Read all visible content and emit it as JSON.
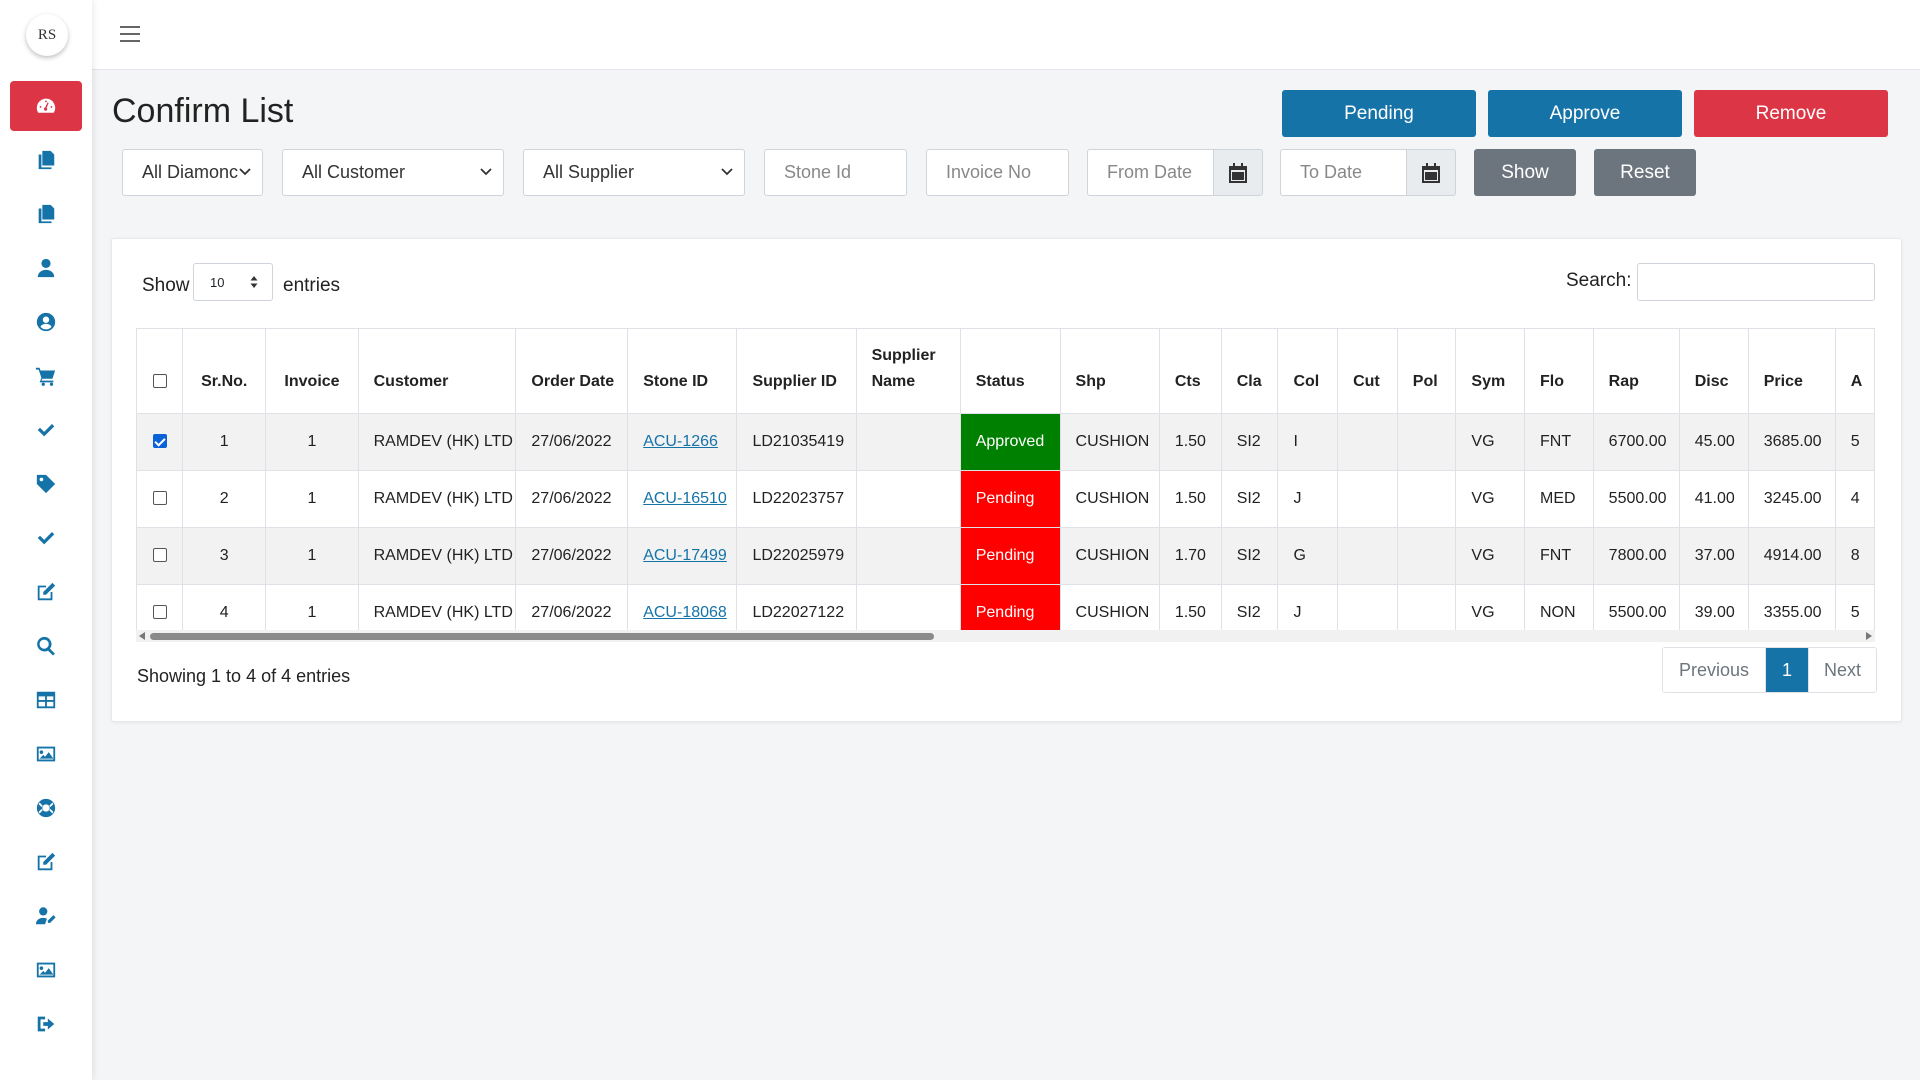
{
  "app": {
    "logo_text": "RS"
  },
  "page": {
    "title": "Confirm List"
  },
  "actions": {
    "pending": "Pending",
    "approve": "Approve",
    "remove": "Remove"
  },
  "filters": {
    "diamond": "All Diamonc",
    "customer": "All Customer",
    "supplier": "All Supplier",
    "stone_id_placeholder": "Stone Id",
    "invoice_placeholder": "Invoice No",
    "from_date_placeholder": "From Date",
    "to_date_placeholder": "To Date",
    "show": "Show",
    "reset": "Reset"
  },
  "table_controls": {
    "show": "Show",
    "entries_value": "10",
    "entries": "entries",
    "search": "Search:"
  },
  "table": {
    "headers": [
      "Sr.No.",
      "Invoice",
      "Customer",
      "Order Date",
      "Stone ID",
      "Supplier ID",
      "Supplier Name",
      "Status",
      "Shp",
      "Cts",
      "Cla",
      "Col",
      "Cut",
      "Pol",
      "Sym",
      "Flo",
      "Rap",
      "Disc",
      "Price",
      "A"
    ],
    "rows": [
      {
        "checked": true,
        "sr": "1",
        "invoice": "1",
        "customer": "RAMDEV (HK) LTD",
        "order_date": "27/06/2022",
        "stone_id": "ACU-1266",
        "supplier_id": "LD21035419",
        "supplier_name": "",
        "status": "Approved",
        "shp": "CUSHION",
        "cts": "1.50",
        "cla": "SI2",
        "col": "I",
        "cut": "",
        "pol": "",
        "sym": "VG",
        "flo": "FNT",
        "rap": "6700.00",
        "disc": "45.00",
        "price": "3685.00",
        "a": "5"
      },
      {
        "checked": false,
        "sr": "2",
        "invoice": "1",
        "customer": "RAMDEV (HK) LTD",
        "order_date": "27/06/2022",
        "stone_id": "ACU-16510",
        "supplier_id": "LD22023757",
        "supplier_name": "",
        "status": "Pending",
        "shp": "CUSHION",
        "cts": "1.50",
        "cla": "SI2",
        "col": "J",
        "cut": "",
        "pol": "",
        "sym": "VG",
        "flo": "MED",
        "rap": "5500.00",
        "disc": "41.00",
        "price": "3245.00",
        "a": "4"
      },
      {
        "checked": false,
        "sr": "3",
        "invoice": "1",
        "customer": "RAMDEV (HK) LTD",
        "order_date": "27/06/2022",
        "stone_id": "ACU-17499",
        "supplier_id": "LD22025979",
        "supplier_name": "",
        "status": "Pending",
        "shp": "CUSHION",
        "cts": "1.70",
        "cla": "SI2",
        "col": "G",
        "cut": "",
        "pol": "",
        "sym": "VG",
        "flo": "FNT",
        "rap": "7800.00",
        "disc": "37.00",
        "price": "4914.00",
        "a": "8"
      },
      {
        "checked": false,
        "sr": "4",
        "invoice": "1",
        "customer": "RAMDEV (HK) LTD",
        "order_date": "27/06/2022",
        "stone_id": "ACU-18068",
        "supplier_id": "LD22027122",
        "supplier_name": "",
        "status": "Pending",
        "shp": "CUSHION",
        "cts": "1.50",
        "cla": "SI2",
        "col": "J",
        "cut": "",
        "pol": "",
        "sym": "VG",
        "flo": "NON",
        "rap": "5500.00",
        "disc": "39.00",
        "price": "3355.00",
        "a": "5"
      }
    ]
  },
  "footer": {
    "info": "Showing 1 to 4 of 4 entries",
    "previous": "Previous",
    "current_page": "1",
    "next": "Next"
  },
  "colors": {
    "primary": "#1573a8",
    "danger": "#dc3545",
    "approved": "#008000",
    "pending": "#ff0000"
  },
  "sidebar_icons": [
    "dashboard-icon",
    "copy-icon",
    "copy-icon",
    "user-icon",
    "user-circle-icon",
    "cart-icon",
    "check-icon",
    "tag-icon",
    "check-icon",
    "edit-icon",
    "search-icon",
    "table-icon",
    "image-icon",
    "lifebuoy-icon",
    "edit-icon",
    "user-edit-icon",
    "image-icon",
    "logout-icon"
  ]
}
